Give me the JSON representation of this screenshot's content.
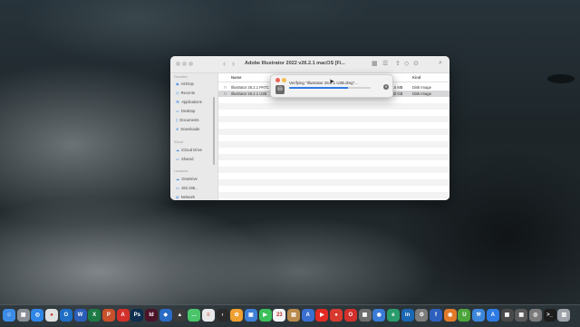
{
  "finder": {
    "title": "Adobe Illustrator 2022 v26.2.1 macOS [Fi...",
    "sidebar": {
      "favorites_heading": "Favorites",
      "favorites": [
        "AirDrop",
        "Recents",
        "Applications",
        "Desktop",
        "Documents",
        "Downloads"
      ],
      "icloud_heading": "iCloud",
      "icloud": [
        "iCloud Drive",
        "Shared"
      ],
      "locations_heading": "Locations",
      "locations": [
        "OneDrive",
        "192.168...",
        "Network"
      ]
    },
    "columns": {
      "name": "Name",
      "kind": "Kind"
    },
    "files": [
      {
        "name": "Illustrator 26.2.1 PATC",
        "size": "20.5 MB",
        "kind": "Disk Image"
      },
      {
        "name": "Illustrator 26.2.1 U2B",
        "size": "1.82 GB",
        "kind": "Disk Image"
      }
    ]
  },
  "dialog": {
    "text": "Verifying \"Illustrator 26.2.1 U2B.dmg\"...",
    "progress": 0.72
  },
  "dock": {
    "icons": [
      {
        "name": "finder-icon",
        "color": "#3c8ce7",
        "glyph": "☺"
      },
      {
        "name": "launchpad-icon",
        "color": "#8a8f95",
        "glyph": "▦"
      },
      {
        "name": "safari-icon",
        "color": "#2f86e6",
        "glyph": "◎"
      },
      {
        "name": "chrome-icon",
        "color": "#e0e0e0",
        "glyph": "●"
      },
      {
        "name": "outlook-icon",
        "color": "#1f6fc5",
        "glyph": "O"
      },
      {
        "name": "word-icon",
        "color": "#2b5eb8",
        "glyph": "W"
      },
      {
        "name": "excel-icon",
        "color": "#1e7a45",
        "glyph": "X"
      },
      {
        "name": "powerpoint-icon",
        "color": "#c8502a",
        "glyph": "P"
      },
      {
        "name": "acrobat-icon",
        "color": "#d3302b",
        "glyph": "A"
      },
      {
        "name": "photoshop-icon",
        "color": "#0d2e4f",
        "glyph": "Ps"
      },
      {
        "name": "indesign-icon",
        "color": "#4b1328",
        "glyph": "Id"
      },
      {
        "name": "sourcetree-icon",
        "color": "#2a6bc4",
        "glyph": "◆"
      },
      {
        "name": "dark-app-icon",
        "color": "#3b3b3b",
        "glyph": "▲"
      },
      {
        "name": "messages-icon",
        "color": "#4ac56a",
        "glyph": "…"
      },
      {
        "name": "notes-icon",
        "color": "#e8e8e8",
        "glyph": "≡"
      },
      {
        "name": "plex-icon",
        "color": "#2b2b2b",
        "glyph": "›"
      },
      {
        "name": "photos-icon",
        "color": "#f0a030",
        "glyph": "✿"
      },
      {
        "name": "keynote-icon",
        "color": "#3f7fd6",
        "glyph": "▣"
      },
      {
        "name": "facetime-icon",
        "color": "#3bbf5a",
        "glyph": "▶"
      },
      {
        "name": "calendar-icon",
        "color": "#f4f4f4",
        "glyph": "23"
      },
      {
        "name": "archive-icon",
        "color": "#b98a4b",
        "glyph": "▤"
      },
      {
        "name": "app-store-icon",
        "color": "#3a6fd0",
        "glyph": "A"
      },
      {
        "name": "youtube-icon",
        "color": "#e22b24",
        "glyph": "▶"
      },
      {
        "name": "vpn-icon",
        "color": "#d83a2f",
        "glyph": "●"
      },
      {
        "name": "opera-icon",
        "color": "#d3302b",
        "glyph": "O"
      },
      {
        "name": "calculator-icon",
        "color": "#6e6e6e",
        "glyph": "▦"
      },
      {
        "name": "reminders-icon",
        "color": "#3a7bd5",
        "glyph": "◉"
      },
      {
        "name": "edge-icon",
        "color": "#2a9b6a",
        "glyph": "e"
      },
      {
        "name": "linkedin-icon",
        "color": "#1a67b3",
        "glyph": "in"
      },
      {
        "name": "settings-icon",
        "color": "#7c7c7c",
        "glyph": "⚙"
      },
      {
        "name": "facebook-icon",
        "color": "#2d5fbd",
        "glyph": "f"
      },
      {
        "name": "rss-icon",
        "color": "#e07a2a",
        "glyph": "◉"
      },
      {
        "name": "upwork-icon",
        "color": "#4da53b",
        "glyph": "U"
      },
      {
        "name": "xcode-icon",
        "color": "#3c86dc",
        "glyph": "⚒"
      },
      {
        "name": "appstore-blue-icon",
        "color": "#2f7be4",
        "glyph": "A"
      },
      {
        "name": "windows-icon",
        "color": "#4a4a4a",
        "glyph": "▦"
      },
      {
        "name": "app-grid-icon",
        "color": "#5a5a5a",
        "glyph": "▦"
      },
      {
        "name": "disk-utility-icon",
        "color": "#7a7a7a",
        "glyph": "◎"
      },
      {
        "name": "terminal-icon",
        "color": "#1d1d1d",
        "glyph": ">_"
      },
      {
        "name": "trash-icon",
        "color": "#9da3a8",
        "glyph": "▥"
      }
    ]
  }
}
